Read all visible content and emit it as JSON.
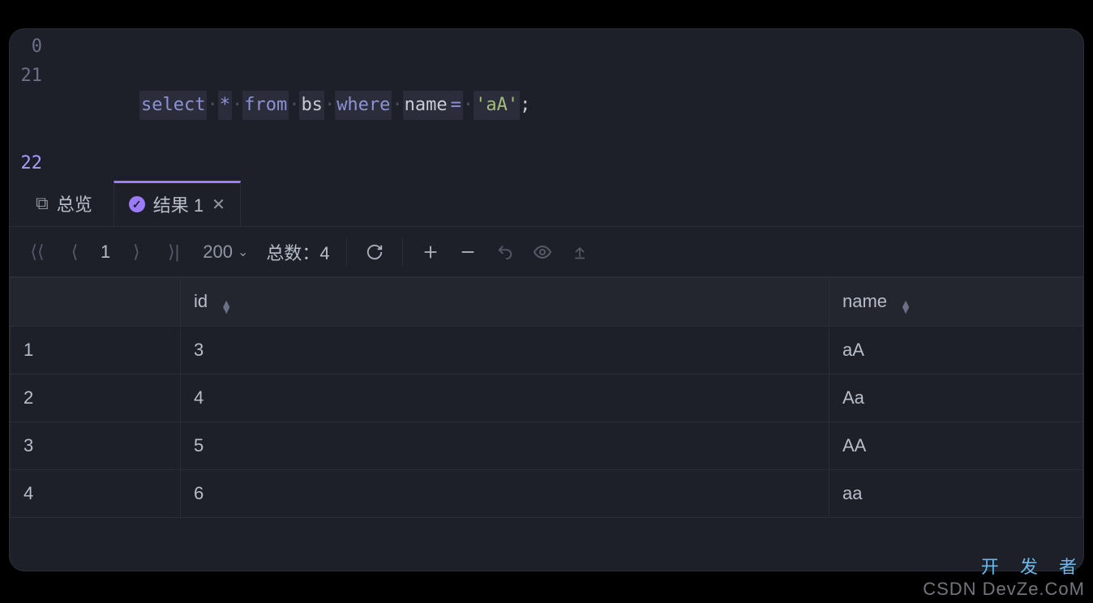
{
  "editor": {
    "lines": [
      {
        "num": "0",
        "tokens": []
      },
      {
        "num": "21",
        "tokens": [
          {
            "t": "select",
            "cls": "tok-kw",
            "hl": true
          },
          {
            "t": "·",
            "cls": "tok-dot"
          },
          {
            "t": "*",
            "cls": "tok-op",
            "hl": true
          },
          {
            "t": "·",
            "cls": "tok-dot"
          },
          {
            "t": "from",
            "cls": "tok-kw",
            "hl": true
          },
          {
            "t": "·",
            "cls": "tok-dot"
          },
          {
            "t": "bs",
            "cls": "tok-ident",
            "hl": true
          },
          {
            "t": "·",
            "cls": "tok-dot"
          },
          {
            "t": "where",
            "cls": "tok-kw",
            "hl": true
          },
          {
            "t": "·",
            "cls": "tok-dot"
          },
          {
            "t": "name",
            "cls": "tok-ident",
            "hl": true
          },
          {
            "t": "=",
            "cls": "tok-op",
            "hl": true
          },
          {
            "t": "·",
            "cls": "tok-dot"
          },
          {
            "t": "'aA'",
            "cls": "tok-str",
            "hl": true
          },
          {
            "t": ";",
            "cls": "tok-semi"
          }
        ]
      },
      {
        "num": "22",
        "tokens": [],
        "current": true
      }
    ]
  },
  "tabs": {
    "overview": "总览",
    "result": "结果 1"
  },
  "toolbar": {
    "page": "1",
    "page_size": "200",
    "total_label": "总数：",
    "total_value": "4"
  },
  "table": {
    "columns": [
      "id",
      "name"
    ],
    "rows": [
      {
        "n": "1",
        "id": "3",
        "name": "aA"
      },
      {
        "n": "2",
        "id": "4",
        "name": "Aa"
      },
      {
        "n": "3",
        "id": "5",
        "name": "AA"
      },
      {
        "n": "4",
        "id": "6",
        "name": "aa"
      }
    ]
  },
  "watermark": {
    "top": "开 发 者",
    "mid": "CSDN DevZe.CoM"
  }
}
